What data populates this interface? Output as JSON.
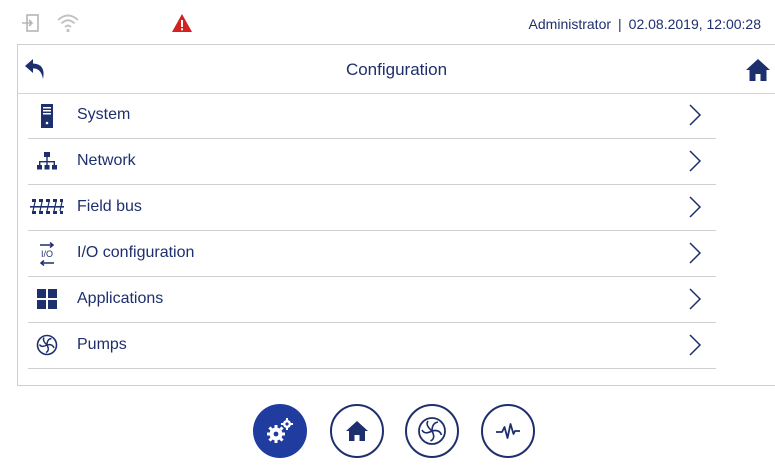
{
  "statusbar": {
    "left_icons": [
      "login-icon",
      "wifi-icon",
      "warning-icon"
    ],
    "user": "Administrator",
    "separator": "|",
    "datetime": "02.08.2019, 12:00:28",
    "colors": {
      "warning": "#d42020",
      "text": "#1e2f6e",
      "muted": "#b5b5b5"
    }
  },
  "panel": {
    "title": "Configuration",
    "back_icon": "back-arrow-icon",
    "home_icon": "home-icon"
  },
  "menu": {
    "items": [
      {
        "label": "System",
        "icon": "server-icon"
      },
      {
        "label": "Network",
        "icon": "network-icon"
      },
      {
        "label": "Field bus",
        "icon": "field-bus-icon"
      },
      {
        "label": "I/O configuration",
        "icon": "io-config-icon"
      },
      {
        "label": "Applications",
        "icon": "applications-icon"
      },
      {
        "label": "Pumps",
        "icon": "pump-icon"
      }
    ],
    "chevron_icon": "chevron-right-icon"
  },
  "bottom_nav": {
    "buttons": [
      {
        "icon": "settings-gears-icon",
        "active": true
      },
      {
        "icon": "home-icon",
        "active": false
      },
      {
        "icon": "pump-icon",
        "active": false
      },
      {
        "icon": "pulse-icon",
        "active": false
      }
    ],
    "colors": {
      "active_fill": "#1f3c9e",
      "outline": "#1e2f6e"
    }
  }
}
